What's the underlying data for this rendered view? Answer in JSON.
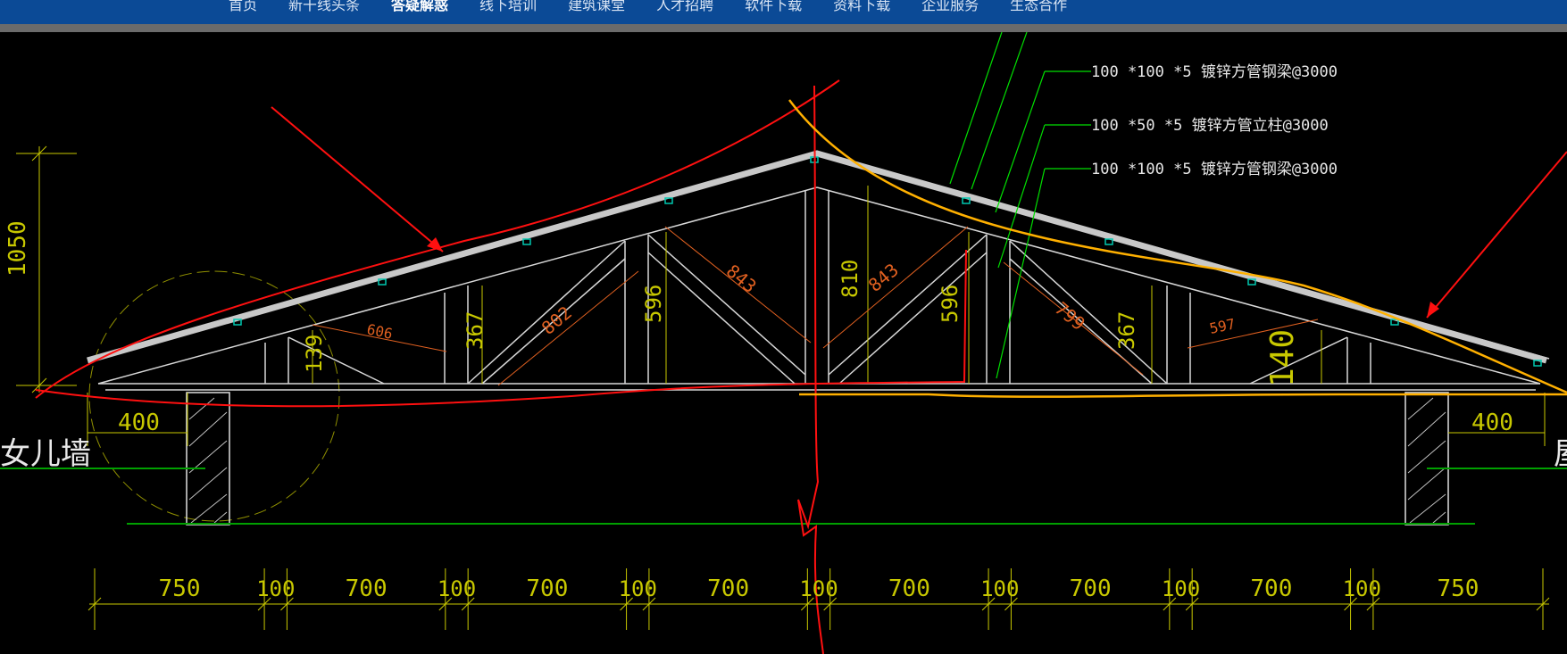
{
  "nav": {
    "items": [
      "首页",
      "新干线头条",
      "答疑解惑",
      "线下培训",
      "建筑课堂",
      "人才招聘",
      "软件下载",
      "资料下载",
      "企业服务",
      "生态合作"
    ],
    "active_index": 2
  },
  "callouts": {
    "c1": "100 *100 *5 镀锌方管钢梁@3000",
    "c2": "100 *50 *5 镀锌方管立柱@3000",
    "c3": "100 *100 *5 镀锌方管钢梁@3000"
  },
  "labels": {
    "left_wall": "女儿墙",
    "right_cut": "屋"
  },
  "dims": {
    "overall_height": "1050",
    "left_overhang": "400",
    "right_overhang": "400",
    "d606": "606",
    "d139": "139",
    "d367l": "367",
    "d802": "802",
    "d596l": "596",
    "d843l": "843",
    "d810": "810",
    "d843r": "843",
    "d596r": "596",
    "d799": "799",
    "d367r": "367",
    "d597": "597",
    "d140": "140"
  },
  "bottom_dims": [
    "750",
    "100",
    "700",
    "100",
    "700",
    "100",
    "700",
    "100",
    "700",
    "100",
    "700",
    "100",
    "700",
    "100",
    "750"
  ],
  "colors": {
    "nav_bg": "#0b4a96",
    "dim_yellow": "#c8c800",
    "dim_orange": "#e06020",
    "callout_green": "#00e000",
    "annot_red": "#ff1010",
    "annot_yellow": "#ffb000",
    "roof_gray": "#c8c8c8",
    "ground_green": "#00a000"
  }
}
